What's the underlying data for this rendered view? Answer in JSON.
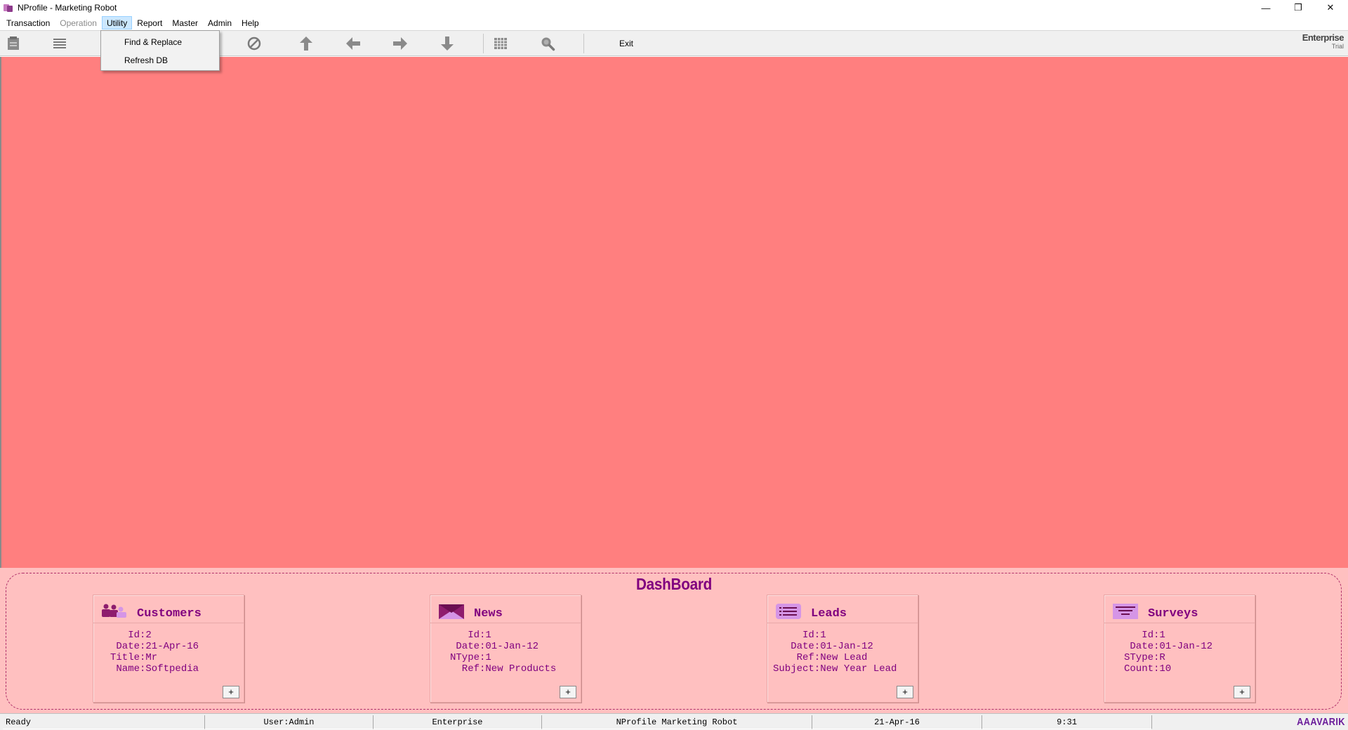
{
  "window": {
    "title": "NProfile - Marketing Robot",
    "minimize": "—",
    "maximize": "❐",
    "close": "✕"
  },
  "menu": {
    "items": [
      {
        "label": "Transaction",
        "state": "normal"
      },
      {
        "label": "Operation",
        "state": "disabled"
      },
      {
        "label": "Utility",
        "state": "open"
      },
      {
        "label": "Report",
        "state": "normal"
      },
      {
        "label": "Master",
        "state": "normal"
      },
      {
        "label": "Admin",
        "state": "normal"
      },
      {
        "label": "Help",
        "state": "normal"
      }
    ],
    "utility_dropdown": [
      {
        "label": "Find & Replace"
      },
      {
        "label": "Refresh DB"
      }
    ]
  },
  "toolbar": {
    "icons": [
      "new-record-icon",
      "list-icon",
      "cancel-icon",
      "first-record-icon",
      "previous-record-icon",
      "next-record-icon",
      "last-record-icon",
      "grid-icon",
      "search-icon"
    ],
    "exit_label": "Exit",
    "edition_name": "Enterprise",
    "edition_type": "Trial"
  },
  "colors": {
    "workspace": "#ff7f7f",
    "dashboard_bg": "#ffc0c0",
    "accent": "#80007f"
  },
  "dashboard": {
    "title": "DashBoard",
    "cards": {
      "customers": {
        "title": "Customers",
        "rows": [
          "   Id:2",
          " Date:21-Apr-16",
          "Title:Mr",
          " Name:Softpedia"
        ]
      },
      "news": {
        "title": "News",
        "rows": [
          "   Id:1",
          " Date:01-Jan-12",
          "NType:1",
          "  Ref:New Products"
        ]
      },
      "leads": {
        "title": "Leads",
        "rows": [
          "     Id:1",
          "   Date:01-Jan-12",
          "    Ref:New Lead",
          "Subject:New Year Lead"
        ]
      },
      "surveys": {
        "title": "Surveys",
        "rows": [
          "   Id:1",
          " Date:01-Jan-12",
          "SType:R",
          "Count:10"
        ]
      }
    },
    "expand_label": "+"
  },
  "status": {
    "ready": "Ready",
    "user": "User:Admin",
    "edition": "Enterprise",
    "product": "NProfile Marketing Robot",
    "date": "21-Apr-16",
    "time": "9:31",
    "brand": "AAAVARIK"
  }
}
